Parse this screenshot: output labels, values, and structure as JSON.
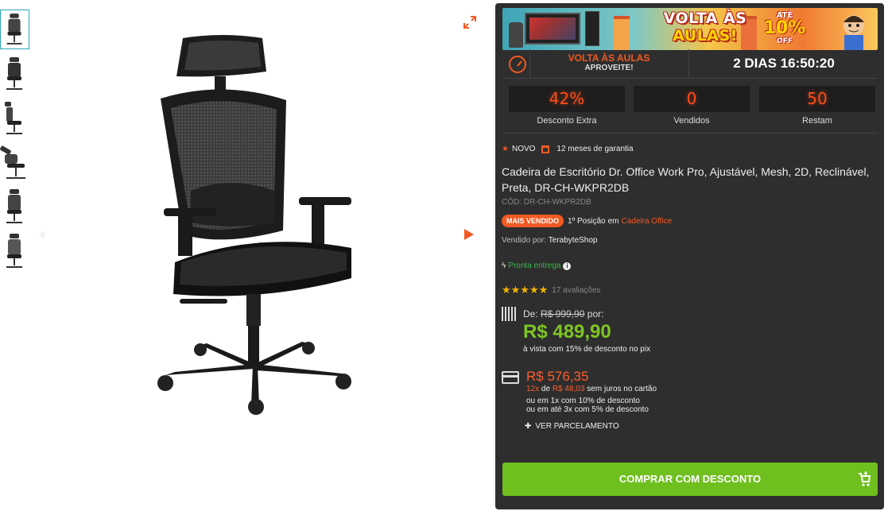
{
  "thumbnails": [
    "thumb-1",
    "thumb-2",
    "thumb-3",
    "thumb-4",
    "thumb-5",
    "thumb-6"
  ],
  "banner": {
    "title_line1": "VOLTA ÀS",
    "title_line2": "AULAS!",
    "promo_ate": "ATÉ",
    "promo_pct": "10%",
    "promo_off": "OFF"
  },
  "promo": {
    "label": "VOLTA ÀS AULAS",
    "sublabel": "APROVEITE!",
    "countdown": "2 DIAS 16:50:20"
  },
  "stats": [
    {
      "value": "42%",
      "label": "Desconto Extra"
    },
    {
      "value": "0",
      "label": "Vendidos"
    },
    {
      "value": "50",
      "label": "Restam"
    }
  ],
  "product": {
    "condition": "NOVO",
    "warranty": "12 meses de garantia",
    "title": "Cadeira de Escritório Dr. Office Work Pro, Ajustável, Mesh, 2D, Reclinável, Preta, DR-CH-WKPR2DB",
    "code": "CÓD: DR-CH-WKPR2DB",
    "best_seller_badge": "MAIS VENDIDO",
    "rank_text": "1º Posição",
    "rank_in": "em",
    "rank_category": "Cadeira Office",
    "seller_label": "Vendido por:",
    "seller_name": "TerabyteShop",
    "availability": "Pronta entrega",
    "rating_stars": "★★★★★",
    "rating_value": 5,
    "rating_count": "17 avaliações"
  },
  "pricing": {
    "from_label": "De:",
    "old_price": "R$ 999,90",
    "for_label": "por:",
    "pix_price": "R$ 489,90",
    "pix_note": "à vista com 15% de desconto no pix",
    "card_price": "R$ 576,35",
    "installments": "12x",
    "installment_of": "de",
    "installment_value": "R$ 48,03",
    "installment_note": "sem juros no cartão",
    "alt1": "ou em 1x com 10% de desconto",
    "alt2": "ou em até 3x com 5% de desconto",
    "ver_parcelamento": "VER PARCELAMENTO"
  },
  "buy_button": "COMPRAR COM DESCONTO",
  "colors": {
    "accent": "#f15a22",
    "buy": "#6fbf1f",
    "pix": "#7dc623",
    "panel": "#2e2e2e"
  }
}
